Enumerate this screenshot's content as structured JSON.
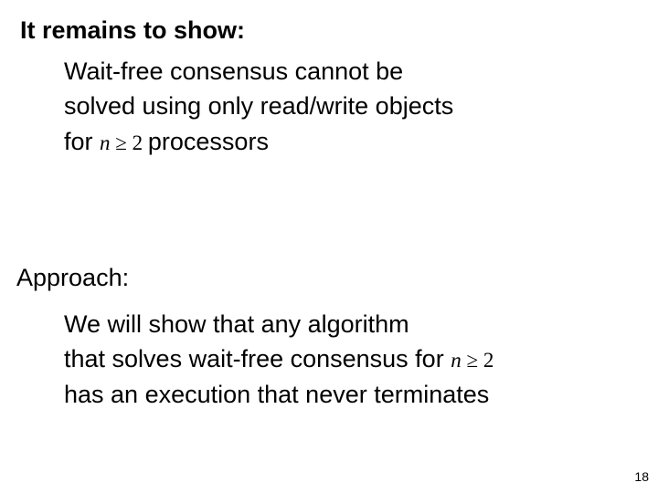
{
  "heading1": "It remains to show:",
  "block1": {
    "l1": "Wait-free consensus cannot be",
    "l2": "solved using only read/write objects",
    "l3a": "for ",
    "math1_var": "n",
    "math1_op": " ≥ ",
    "math1_num": "2",
    "l3b": "  processors"
  },
  "heading2": "Approach:",
  "block2": {
    "l1": "We will show that any algorithm",
    "l2a": "that solves wait-free consensus for  ",
    "math2_var": "n",
    "math2_op": " ≥ ",
    "math2_num": "2",
    "l3": "has an execution that never terminates"
  },
  "pagenum": "18"
}
